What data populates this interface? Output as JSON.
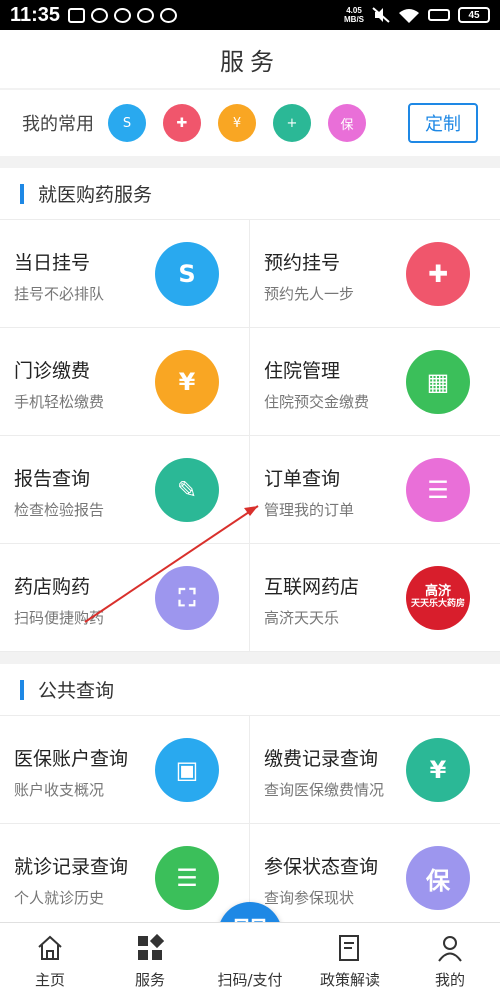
{
  "status_bar": {
    "time": "11:35",
    "net_speed_value": "4.05",
    "net_speed_unit": "MB/S",
    "battery": "45"
  },
  "header": {
    "title": "服务"
  },
  "favorites": {
    "label": "我的常用",
    "icons": [
      {
        "name": "registration-icon",
        "color": "#29a9ef",
        "glyph": "S"
      },
      {
        "name": "medical-cross-icon",
        "color": "#f0566c",
        "glyph": "✚"
      },
      {
        "name": "payment-icon",
        "color": "#f9a623",
        "glyph": "¥"
      },
      {
        "name": "report-icon",
        "color": "#2bb896",
        "glyph": "+"
      },
      {
        "name": "insurance-icon",
        "color": "#e96fd8",
        "glyph": "保"
      }
    ],
    "customize_label": "定制"
  },
  "sections": [
    {
      "title": "就医购药服务",
      "items": [
        {
          "title": "当日挂号",
          "subtitle": "挂号不必排队",
          "color": "#29a9ef",
          "glyph": "S",
          "icon": "same-day-registration-icon"
        },
        {
          "title": "预约挂号",
          "subtitle": "预约先人一步",
          "color": "#f0566c",
          "glyph": "✚",
          "icon": "appointment-icon"
        },
        {
          "title": "门诊缴费",
          "subtitle": "手机轻松缴费",
          "color": "#f9a623",
          "glyph": "¥",
          "icon": "outpatient-payment-icon"
        },
        {
          "title": "住院管理",
          "subtitle": "住院预交金缴费",
          "color": "#3bbf5a",
          "glyph": "▦",
          "icon": "hospital-building-icon"
        },
        {
          "title": "报告查询",
          "subtitle": "检查检验报告",
          "color": "#2bb896",
          "glyph": "✎",
          "icon": "report-query-icon"
        },
        {
          "title": "订单查询",
          "subtitle": "管理我的订单",
          "color": "#e96fd8",
          "glyph": "☰",
          "icon": "clipboard-icon"
        },
        {
          "title": "药店购药",
          "subtitle": "扫码便捷购药",
          "color": "#9d96ee",
          "glyph": "⛶",
          "icon": "scan-icon"
        },
        {
          "title": "互联网药店",
          "subtitle": "高济天天乐",
          "color": "#d81e2c",
          "glyph": "",
          "icon": "pharmacy-logo",
          "logo_text_top": "高济",
          "logo_text_bottom": "天天乐大药房"
        }
      ]
    },
    {
      "title": "公共查询",
      "items": [
        {
          "title": "医保账户查询",
          "subtitle": "账户收支概况",
          "color": "#29a9ef",
          "glyph": "▣",
          "icon": "id-card-icon"
        },
        {
          "title": "缴费记录查询",
          "subtitle": "查询医保缴费情况",
          "color": "#2bb896",
          "glyph": "¥",
          "icon": "payment-record-icon"
        },
        {
          "title": "就诊记录查询",
          "subtitle": "个人就诊历史",
          "color": "#3bbf5a",
          "glyph": "☰",
          "icon": "visit-record-icon"
        },
        {
          "title": "参保状态查询",
          "subtitle": "查询参保现状",
          "color": "#9d96ee",
          "glyph": "保",
          "icon": "insurance-status-icon"
        }
      ]
    }
  ],
  "tabbar": {
    "items": [
      {
        "label": "主页",
        "icon": "home-icon"
      },
      {
        "label": "服务",
        "icon": "services-icon"
      },
      {
        "label": "扫码/支付",
        "icon": "qr-code-icon"
      },
      {
        "label": "政策解读",
        "icon": "policy-icon"
      },
      {
        "label": "我的",
        "icon": "profile-icon"
      }
    ]
  }
}
